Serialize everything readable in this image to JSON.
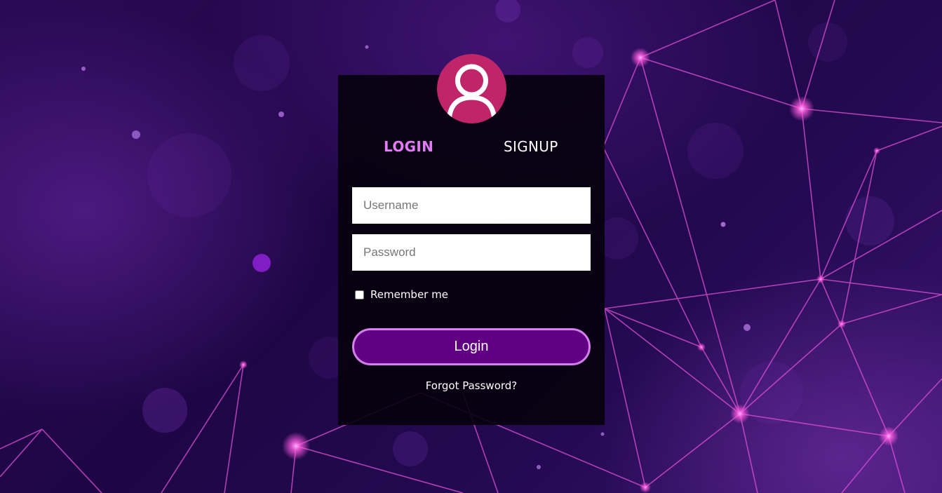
{
  "tabs": {
    "login_label": "LOGIN",
    "signup_label": "SIGNUP",
    "active": "login"
  },
  "form": {
    "username_placeholder": "Username",
    "username_value": "",
    "password_placeholder": "Password",
    "password_value": "",
    "remember_label": "Remember me",
    "remember_checked": false,
    "submit_label": "Login",
    "forgot_label": "Forgot Password?"
  },
  "icons": {
    "avatar": "user-icon"
  },
  "colors": {
    "avatar_bg": "#c0256a",
    "active_tab": "#e27bf5",
    "button_bg": "#620083",
    "button_border": "#d77ef0",
    "card_bg": "#06010c",
    "network_lines": "#e050d8"
  }
}
